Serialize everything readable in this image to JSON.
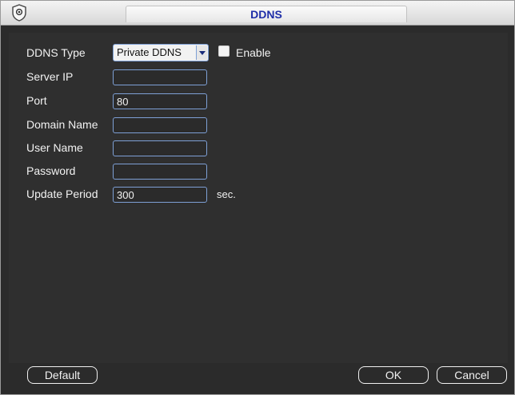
{
  "window": {
    "title": "DDNS",
    "icon": "camera-logo-icon"
  },
  "form": {
    "ddns_type": {
      "label": "DDNS Type",
      "value": "Private DDNS"
    },
    "enable": {
      "label": "Enable",
      "checked": false
    },
    "server_ip": {
      "label": "Server IP",
      "value": ""
    },
    "port": {
      "label": "Port",
      "value": "80"
    },
    "domain_name": {
      "label": "Domain Name",
      "value": ""
    },
    "user_name": {
      "label": "User Name",
      "value": ""
    },
    "password": {
      "label": "Password",
      "value": ""
    },
    "update_period": {
      "label": "Update Period",
      "value": "300",
      "unit": "sec."
    }
  },
  "buttons": {
    "default": "Default",
    "ok": "OK",
    "cancel": "Cancel"
  }
}
